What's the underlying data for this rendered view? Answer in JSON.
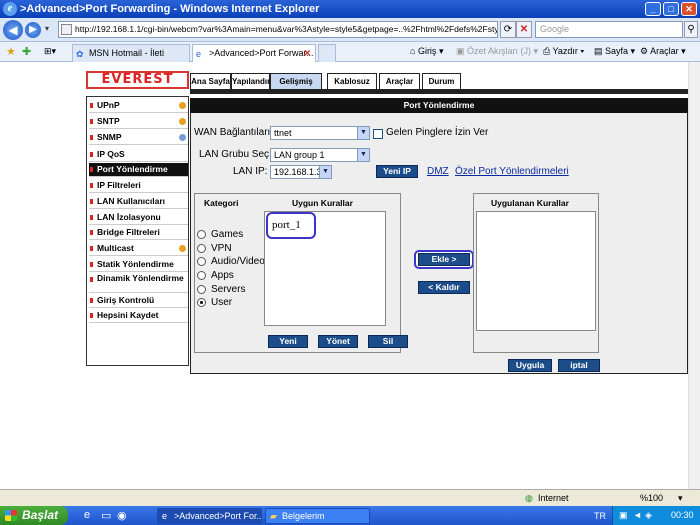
{
  "window": {
    "title": ">Advanced>Port Forwarding - Windows Internet Explorer",
    "minimize": "_",
    "maximize": "□",
    "close": "✕"
  },
  "address": {
    "url": "http://192.168.1.1/cgi-bin/webcm?var%3Amain=menu&var%3Astyle=style5&getpage=..%2Fhtml%2Fdefs%2Fstyle5%2Fi",
    "search_placeholder": "Google"
  },
  "tabs": [
    {
      "label": "MSN Hotmail - İleti"
    },
    {
      "label": ">Advanced>Port Forwar..."
    }
  ],
  "toolbar": {
    "home": "Giriş",
    "feeds": "Özet Akışları (J)",
    "print": "Yazdır",
    "page": "Sayfa",
    "tools": "Araçlar"
  },
  "router": {
    "logo": "EVEREST",
    "top_menu": [
      "Ana Sayfa",
      "Yapılandır",
      "Gelişmiş",
      "Kablosuz",
      "Araçlar",
      "Durum"
    ],
    "nav": [
      {
        "label": "UPnP"
      },
      {
        "label": "SNTP"
      },
      {
        "label": "SNMP"
      },
      {
        "label": "IP QoS"
      },
      {
        "label": "Port Yönlendirme"
      },
      {
        "label": "IP Filtreleri"
      },
      {
        "label": "LAN Kullanıcıları"
      },
      {
        "label": "LAN İzolasyonu"
      },
      {
        "label": "Bridge Filtreleri"
      },
      {
        "label": "Multicast"
      },
      {
        "label": "Statik Yönlendirme"
      },
      {
        "label": "Dinamik Yönlendirme"
      },
      {
        "label": "Giriş Kontrolü"
      },
      {
        "label": "Hepsini Kaydet"
      }
    ],
    "main_title": "Port Yönlendirme",
    "wan_label": "WAN Bağlantıları:",
    "wan_value": "ttnet",
    "ping_label": "Gelen Pinglere İzin Ver",
    "lan_group_label": "LAN Grubu Seç:",
    "lan_group_value": "LAN group 1",
    "lan_ip_label": "LAN IP:",
    "lan_ip_value": "192.168.1.3",
    "new_ip_button": "Yeni IP",
    "dmz_link": "DMZ",
    "custom_link": "Özel Port Yönlendirmeleri",
    "category_title": "Kategori",
    "categories": [
      "Games",
      "VPN",
      "Audio/Video",
      "Apps",
      "Servers",
      "User"
    ],
    "rules_title": "Uygun Kurallar",
    "rule_item": "port_1",
    "applied_title": "Uygulanan Kurallar",
    "add_button": "Ekle >",
    "remove_button": "< Kaldır",
    "new_button": "Yeni",
    "manage_button": "Yönet",
    "delete_button": "Sil",
    "apply_button": "Uygula",
    "cancel_button": "iptal"
  },
  "statusbar": {
    "zone": "Internet",
    "zoom": "%100"
  },
  "taskbar": {
    "start": "Başlat",
    "items": [
      ">Advanced>Port For...",
      "Belgelerim"
    ],
    "lang": "TR",
    "time": "00:30"
  }
}
